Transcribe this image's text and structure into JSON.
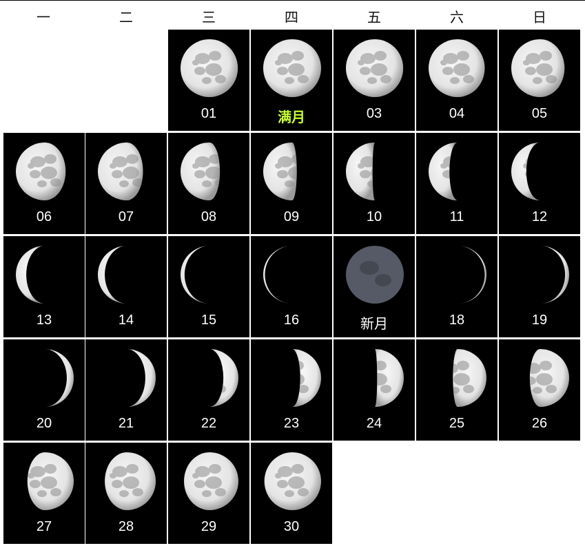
{
  "weekdays": [
    "一",
    "二",
    "三",
    "四",
    "五",
    "六",
    "日"
  ],
  "start_weekday_index": 2,
  "days": [
    {
      "label": "01",
      "illum": 0.99,
      "wax": false
    },
    {
      "label": "满月",
      "illum": 1.0,
      "wax": false,
      "highlight": "#c6ff2b"
    },
    {
      "label": "03",
      "illum": 0.99,
      "wax": false
    },
    {
      "label": "04",
      "illum": 0.97,
      "wax": false
    },
    {
      "label": "05",
      "illum": 0.92,
      "wax": false
    },
    {
      "label": "06",
      "illum": 0.86,
      "wax": false
    },
    {
      "label": "07",
      "illum": 0.78,
      "wax": false
    },
    {
      "label": "08",
      "illum": 0.68,
      "wax": false
    },
    {
      "label": "09",
      "illum": 0.58,
      "wax": false
    },
    {
      "label": "10",
      "illum": 0.46,
      "wax": false
    },
    {
      "label": "11",
      "illum": 0.36,
      "wax": false
    },
    {
      "label": "12",
      "illum": 0.26,
      "wax": false
    },
    {
      "label": "13",
      "illum": 0.18,
      "wax": false
    },
    {
      "label": "14",
      "illum": 0.12,
      "wax": false
    },
    {
      "label": "15",
      "illum": 0.07,
      "wax": false
    },
    {
      "label": "16",
      "illum": 0.03,
      "wax": false
    },
    {
      "label": "新月",
      "illum": 0.0,
      "wax": true
    },
    {
      "label": "18",
      "illum": 0.03,
      "wax": true
    },
    {
      "label": "19",
      "illum": 0.07,
      "wax": true
    },
    {
      "label": "20",
      "illum": 0.12,
      "wax": true
    },
    {
      "label": "21",
      "illum": 0.18,
      "wax": true
    },
    {
      "label": "22",
      "illum": 0.26,
      "wax": true
    },
    {
      "label": "23",
      "illum": 0.36,
      "wax": true
    },
    {
      "label": "24",
      "illum": 0.46,
      "wax": true
    },
    {
      "label": "25",
      "illum": 0.58,
      "wax": true
    },
    {
      "label": "26",
      "illum": 0.68,
      "wax": true
    },
    {
      "label": "27",
      "illum": 0.8,
      "wax": true
    },
    {
      "label": "28",
      "illum": 0.88,
      "wax": true
    },
    {
      "label": "29",
      "illum": 0.94,
      "wax": true
    },
    {
      "label": "30",
      "illum": 0.98,
      "wax": true
    }
  ],
  "colors": {
    "cell_bg": "#000000",
    "label": "#ffffff",
    "full_moon_label": "#c6ff2b",
    "moon_lit": "#e4e4e4",
    "new_moon": "#555a66"
  }
}
